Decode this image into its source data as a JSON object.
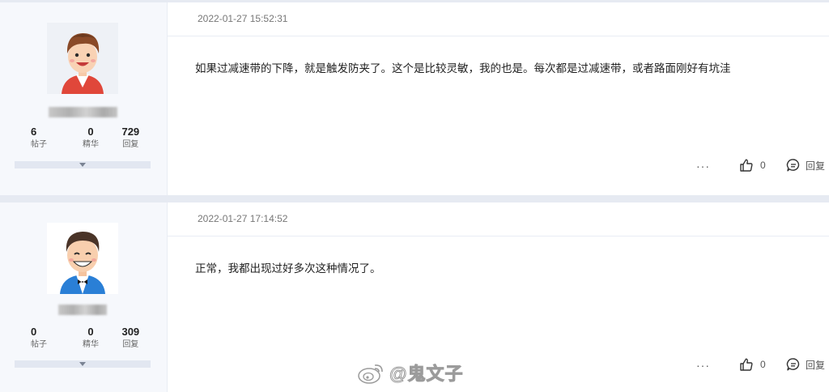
{
  "posts": [
    {
      "user": {
        "stats": [
          {
            "value": "6",
            "label": "帖子"
          },
          {
            "value": "0",
            "label": "精华"
          },
          {
            "value": "729",
            "label": "回复"
          }
        ]
      },
      "timestamp": "2022-01-27 15:52:31",
      "content": "如果过减速带的下降，就是触发防夹了。这个是比较灵敏，我的也是。每次都是过减速带，或者路面刚好有坑洼",
      "actions": {
        "more": "···",
        "likes": "0",
        "reply": "回复"
      }
    },
    {
      "user": {
        "stats": [
          {
            "value": "0",
            "label": "帖子"
          },
          {
            "value": "0",
            "label": "精华"
          },
          {
            "value": "309",
            "label": "回复"
          }
        ]
      },
      "timestamp": "2022-01-27 17:14:52",
      "content": "正常，我都出现过好多次这种情况了。",
      "actions": {
        "more": "···",
        "likes": "0",
        "reply": "回复"
      }
    }
  ],
  "watermark": {
    "text": "@鬼文子",
    "icon": "weibo-logo"
  },
  "colors": {
    "separator": "#e6eaf2",
    "sidebar": "#f6f8fc"
  }
}
